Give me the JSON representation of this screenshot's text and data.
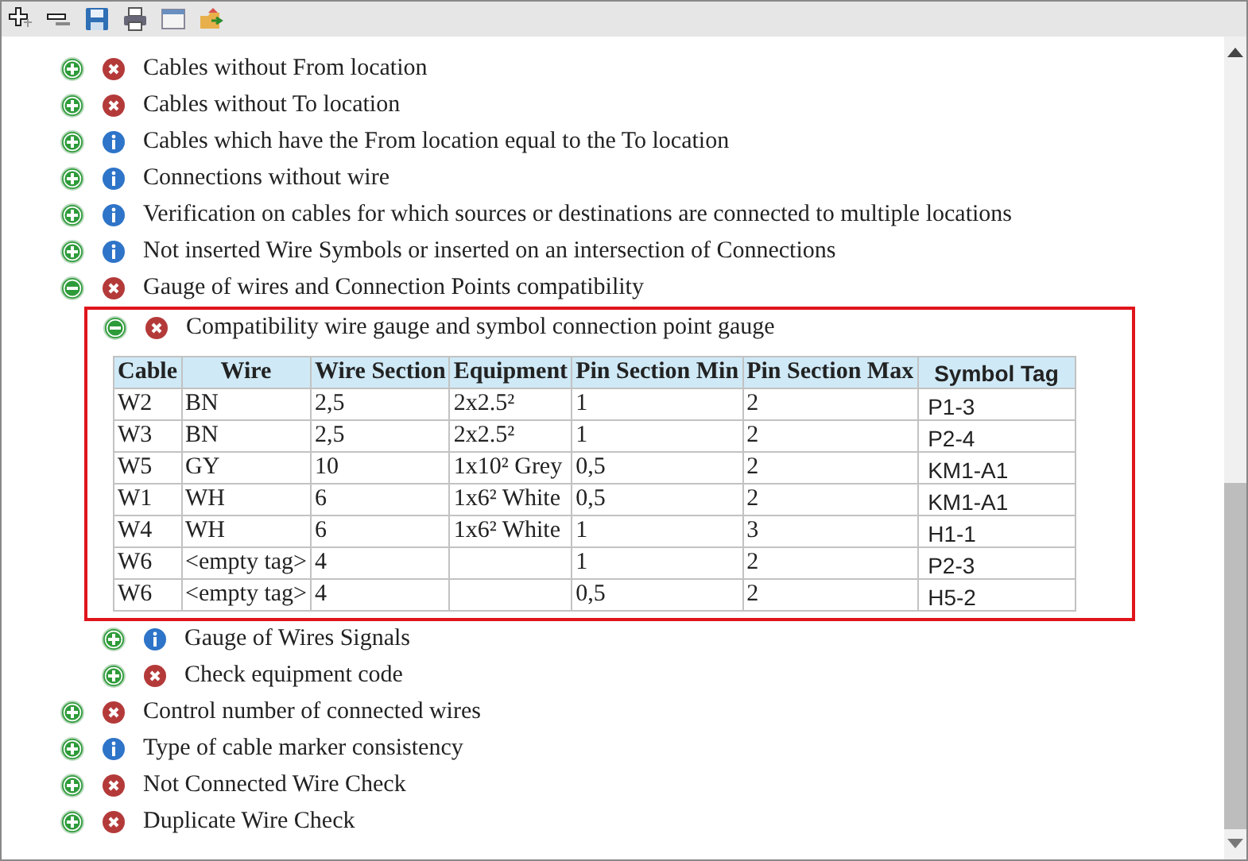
{
  "toolbar": {
    "buttons": [
      {
        "kind": "expand"
      },
      {
        "kind": "collapse"
      },
      {
        "kind": "save"
      },
      {
        "kind": "print"
      },
      {
        "kind": "window"
      },
      {
        "kind": "export"
      }
    ]
  },
  "tree": [
    {
      "label": "Cables without From location",
      "kind": "error",
      "expanded": false,
      "highlighted": false
    },
    {
      "label": "Cables without To location",
      "kind": "error",
      "expanded": false,
      "highlighted": false
    },
    {
      "label": "Cables which have the From location equal to the To location",
      "kind": "info",
      "expanded": false,
      "highlighted": false
    },
    {
      "label": "Connections without wire",
      "kind": "info",
      "expanded": false,
      "highlighted": false
    },
    {
      "label": "Verification on cables for which sources or destinations are connected to multiple locations",
      "kind": "info",
      "expanded": false,
      "highlighted": false
    },
    {
      "label": "Not inserted Wire Symbols or inserted on an intersection of Connections",
      "kind": "info",
      "expanded": false,
      "highlighted": false
    },
    {
      "label": "Gauge of wires and Connection Points compatibility",
      "kind": "error",
      "expanded": true,
      "highlighted": false,
      "children": [
        {
          "label": "Compatibility wire gauge and symbol connection point gauge",
          "kind": "error",
          "expanded": true,
          "highlighted": true,
          "table": {
            "columns": [
              {
                "label": "Cable",
                "kind": "text"
              },
              {
                "label": "Wire",
                "kind": "text"
              },
              {
                "label": "Wire Section",
                "kind": "text"
              },
              {
                "label": "Equipment",
                "kind": "text"
              },
              {
                "label": "Pin Section Min",
                "kind": "text"
              },
              {
                "label": "Pin Section Max",
                "kind": "text"
              },
              {
                "label": "Symbol Tag",
                "kind": "tag"
              }
            ],
            "rows": [
              [
                "W2",
                "BN",
                "2,5",
                "2x2.5²",
                "1",
                "2",
                "P1-3"
              ],
              [
                "W3",
                "BN",
                "2,5",
                "2x2.5²",
                "1",
                "2",
                "P2-4"
              ],
              [
                "W5",
                "GY",
                "10",
                "1x10² Grey",
                "0,5",
                "2",
                "KM1-A1"
              ],
              [
                "W1",
                "WH",
                "6",
                "1x6² White",
                "0,5",
                "2",
                "KM1-A1"
              ],
              [
                "W4",
                "WH",
                "6",
                "1x6² White",
                "1",
                "3",
                "H1-1"
              ],
              [
                "W6",
                "<empty tag>",
                "4",
                "",
                "1",
                "2",
                "P2-3"
              ],
              [
                "W6",
                "<empty tag>",
                "4",
                "",
                "0,5",
                "2",
                "H5-2"
              ]
            ]
          }
        },
        {
          "label": "Gauge of Wires Signals",
          "kind": "info",
          "expanded": false,
          "highlighted": false
        },
        {
          "label": "Check equipment code",
          "kind": "error",
          "expanded": false,
          "highlighted": false
        }
      ]
    },
    {
      "label": "Control number of connected wires",
      "kind": "error",
      "expanded": false,
      "highlighted": false
    },
    {
      "label": "Type of cable marker consistency",
      "kind": "info",
      "expanded": false,
      "highlighted": false
    },
    {
      "label": "Not Connected Wire Check",
      "kind": "error",
      "expanded": false,
      "highlighted": false
    },
    {
      "label": "Duplicate Wire Check",
      "kind": "error",
      "expanded": false,
      "highlighted": false
    }
  ]
}
